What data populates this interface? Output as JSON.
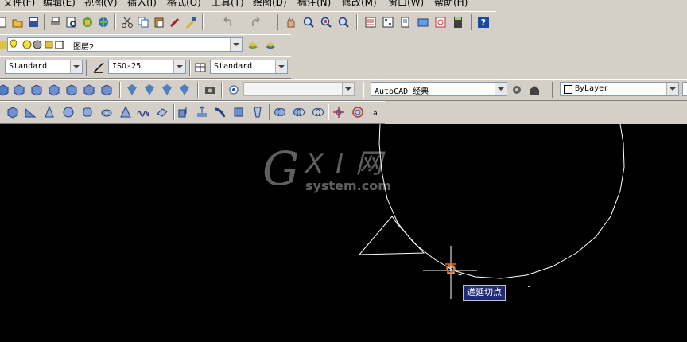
{
  "menu": {
    "items": [
      "文件(F)",
      "编辑(E)",
      "视图(V)",
      "插入(I)",
      "格式(O)",
      "工具(T)",
      "绘图(D)",
      "标注(N)",
      "修改(M)",
      "窗口(W)",
      "帮助(H)"
    ]
  },
  "layers": {
    "current_layer": "图层2"
  },
  "styles": {
    "text_style": "Standard",
    "dim_style": "ISO-25",
    "table_style": "Standard"
  },
  "workspace": {
    "name": "AutoCAD 经典"
  },
  "properties": {
    "color": "ByLayer"
  },
  "canvas": {
    "tooltip": "递延切点"
  },
  "watermark": {
    "brand_g": "G",
    "brand_xi": "X I 网",
    "brand_sub": "system.com"
  },
  "colors": {
    "toolbar_bg": "#d4d0c8",
    "canvas_bg": "#000000",
    "tooltip_bg": "#1e2a78",
    "drawing_line": "#ffffff",
    "cursor": "#ffffff",
    "snap_marker": "#e07020"
  }
}
